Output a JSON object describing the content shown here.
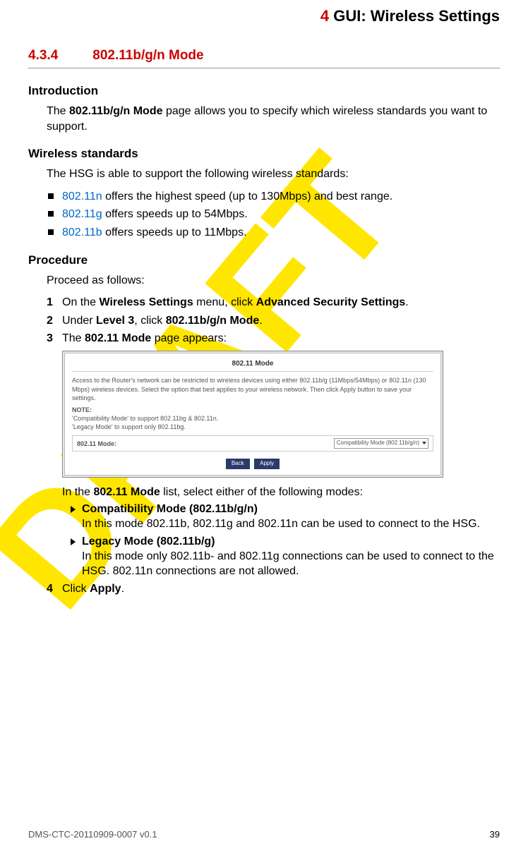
{
  "header": {
    "chapter_num": "4",
    "chapter_title": "GUI: Wireless Settings"
  },
  "section": {
    "number": "4.3.4",
    "title": "802.11b/g/n Mode"
  },
  "intro": {
    "heading": "Introduction",
    "text_pre": "The ",
    "text_bold": "802.11b/g/n Mode",
    "text_post": " page allows you to specify which wireless standards you want to support."
  },
  "standards": {
    "heading": "Wireless standards",
    "lead": "The HSG is able to support the following wireless standards:",
    "items": [
      {
        "link": "802.11n",
        "rest": " offers the highest speed (up to 130Mbps) and best range."
      },
      {
        "link": "802.11g",
        "rest": " offers speeds up to 54Mbps."
      },
      {
        "link": "802.11b",
        "rest": " offers speeds up to 11Mbps."
      }
    ]
  },
  "procedure": {
    "heading": "Procedure",
    "lead": "Proceed as follows:",
    "step1": {
      "pre": "On the ",
      "b1": "Wireless Settings",
      "mid": " menu, click ",
      "b2": "Advanced Security Settings",
      "post": "."
    },
    "step2": {
      "pre": "Under ",
      "b1": "Level 3",
      "mid": ", click ",
      "b2": "802.11b/g/n Mode",
      "post": "."
    },
    "step3": {
      "pre": "The ",
      "b1": "802.11 Mode",
      "post": " page appears:"
    },
    "step3_after": {
      "pre": "In the ",
      "b1": "802.11 Mode",
      "post": " list, select either of the following modes:"
    },
    "modes": [
      {
        "title": "Compatibility Mode (802.11b/g/n)",
        "desc": "In this mode 802.11b, 802.11g and 802.11n can be used to connect to the HSG."
      },
      {
        "title": "Legacy Mode (802.11b/g)",
        "desc": "In this mode only 802.11b- and 802.11g connections can be used to connect to the HSG. 802.11n connections are not allowed."
      }
    ],
    "step4": {
      "pre": "Click ",
      "b1": "Apply",
      "post": "."
    }
  },
  "screenshot": {
    "title": "802.11 Mode",
    "desc": "Access to the Router's network can be restricted to wireless devices using either 802.11b/g (11Mbps/54Mbps) or 802.11n (130 Mbps) wireless devices. Select the option that best applies to your wireless network. Then click Apply button to save your settings.",
    "note_label": "NOTE:",
    "note1": "'Compatibility Mode' to support 802.11bg & 802.11n.",
    "note2": "'Legacy Mode' to support only 802.11bg.",
    "row_label": "802.11 Mode:",
    "select_value": "Compatibility Mode (802.11b/g/n)",
    "btn_back": "Back",
    "btn_apply": "Apply"
  },
  "footer": {
    "doc": "DMS-CTC-20110909-0007 v0.1",
    "page": "39"
  }
}
